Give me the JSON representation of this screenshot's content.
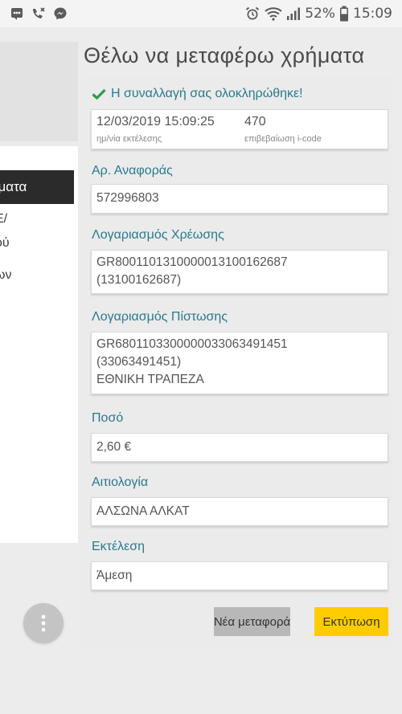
{
  "status_bar": {
    "battery_percent": "52%",
    "time": "15:09",
    "left_icons": [
      "notification-icon",
      "missed-call-icon",
      "messenger-icon"
    ],
    "right_icons": [
      "alarm-icon",
      "wifi-icon",
      "signal-icon",
      "battery-icon"
    ]
  },
  "drawer": {
    "active_item": "ήματα",
    "items": [
      "Ε/",
      "ού",
      "ων"
    ]
  },
  "page": {
    "title": "Θέλω να μεταφέρω χρήματα"
  },
  "confirmation": {
    "message": "Η συναλλαγή σας ολοκληρώθηκε!",
    "datetime": "12/03/2019 15:09:25",
    "datetime_label": "ημ/νία εκτέλεσης",
    "icode": "470",
    "icode_label": "επιβεβαίωση i-code"
  },
  "fields": {
    "reference_label": "Αρ. Αναφοράς",
    "reference_value": "572996803",
    "debit_label": "Λογαριασμός Χρέωσης",
    "debit_iban": "GR8001101310000013100162687",
    "debit_account": "(13100162687)",
    "credit_label": "Λογαριασμός Πίστωσης",
    "credit_iban": "GR6801103300000033063491451",
    "credit_account": "(33063491451)",
    "credit_bank": "ΕΘΝΙΚΗ ΤΡΑΠΕΖΑ",
    "amount_label": "Ποσό",
    "amount_value": "2,60 €",
    "reason_label": "Αιτιολογία",
    "reason_value": "ΑΛΣΩΝΑ ΑΛΚΑΤ",
    "execution_label": "Εκτέλεση",
    "execution_value": "Άμεση"
  },
  "actions": {
    "new_transfer": "Νέα μεταφορά",
    "print": "Εκτύπωση"
  },
  "colors": {
    "accent": "#2a7a8c",
    "success": "#2e9a4a",
    "print_button": "#ffcc00",
    "drawer_active": "#2b2b2b"
  }
}
